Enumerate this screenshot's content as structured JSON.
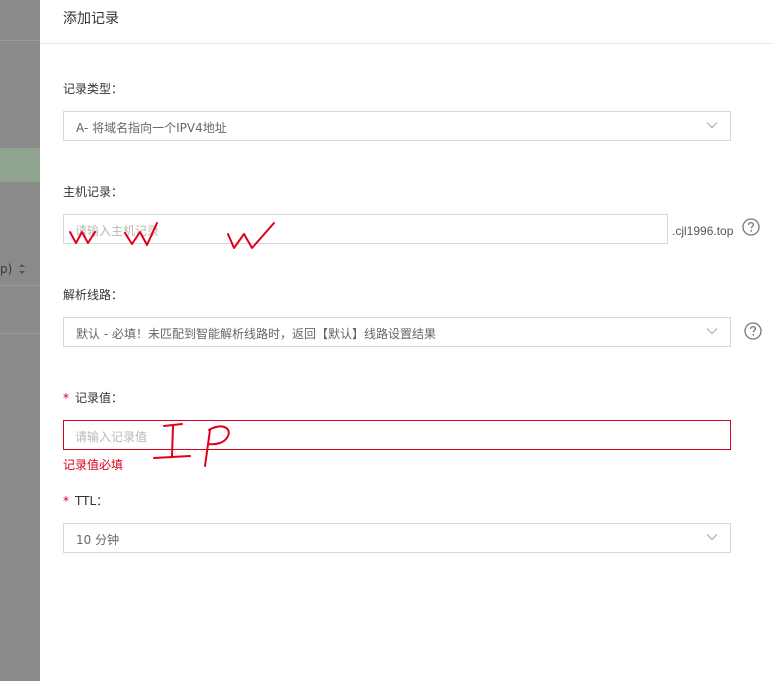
{
  "panel": {
    "title": "添加记录"
  },
  "background": {
    "sort_label": "p)"
  },
  "fields": {
    "record_type": {
      "label": "记录类型：",
      "value": "A- 将域名指向一个IPV4地址"
    },
    "host_record": {
      "label": "主机记录：",
      "placeholder": "请输入主机记录",
      "suffix": ".cjl1996.top"
    },
    "line": {
      "label": "解析线路：",
      "value": "默认 - 必填！未匹配到智能解析线路时，返回【默认】线路设置结果"
    },
    "record_value": {
      "required_mark": "*",
      "label": "记录值：",
      "placeholder": "请输入记录值",
      "error": "记录值必填"
    },
    "ttl": {
      "required_mark": "*",
      "label": "TTL：",
      "value": "10 分钟"
    }
  },
  "annotations": {
    "host_scribble_color": "#e0001b",
    "value_scribble_color": "#e0001b"
  },
  "colors": {
    "error": "#d9001b",
    "border": "#d7d8d9"
  }
}
